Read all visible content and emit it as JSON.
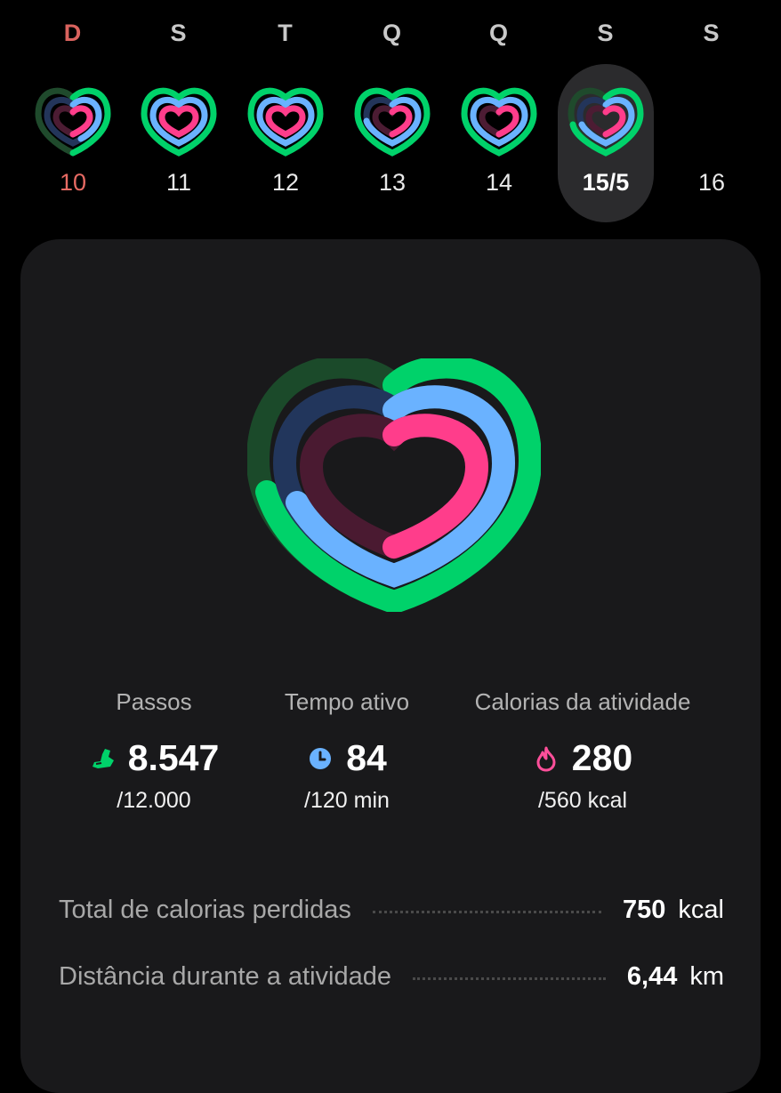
{
  "week": {
    "days": [
      {
        "letter": "D",
        "date": "10"
      },
      {
        "letter": "S",
        "date": "11"
      },
      {
        "letter": "T",
        "date": "12"
      },
      {
        "letter": "Q",
        "date": "13"
      },
      {
        "letter": "Q",
        "date": "14"
      },
      {
        "letter": "S",
        "date": "15/5",
        "selected": true
      },
      {
        "letter": "S",
        "date": "16"
      }
    ],
    "colors": {
      "sunday": "#e76a63",
      "selected_bg": "#2b2b2d"
    }
  },
  "rings": {
    "steps_color": "#00d26a",
    "active_time_color": "#6ab2ff",
    "calories_color": "#ff3d8b"
  },
  "stats": {
    "steps": {
      "label": "Passos",
      "value": "8.547",
      "goal": "/12.000",
      "icon": "shoe-icon",
      "progress": 0.71
    },
    "active_time": {
      "label": "Tempo ativo",
      "value": "84",
      "goal": "/120 min",
      "icon": "clock-icon",
      "progress": 0.7
    },
    "calories": {
      "label": "Calorias da atividade",
      "value": "280",
      "goal": "/560 kcal",
      "icon": "flame-icon",
      "progress": 0.5
    }
  },
  "totals": {
    "calories": {
      "label": "Total de calorias perdidas",
      "value": "750",
      "unit": "kcal"
    },
    "distance": {
      "label": "Distância durante a atividade",
      "value": "6,44",
      "unit": "km"
    }
  }
}
